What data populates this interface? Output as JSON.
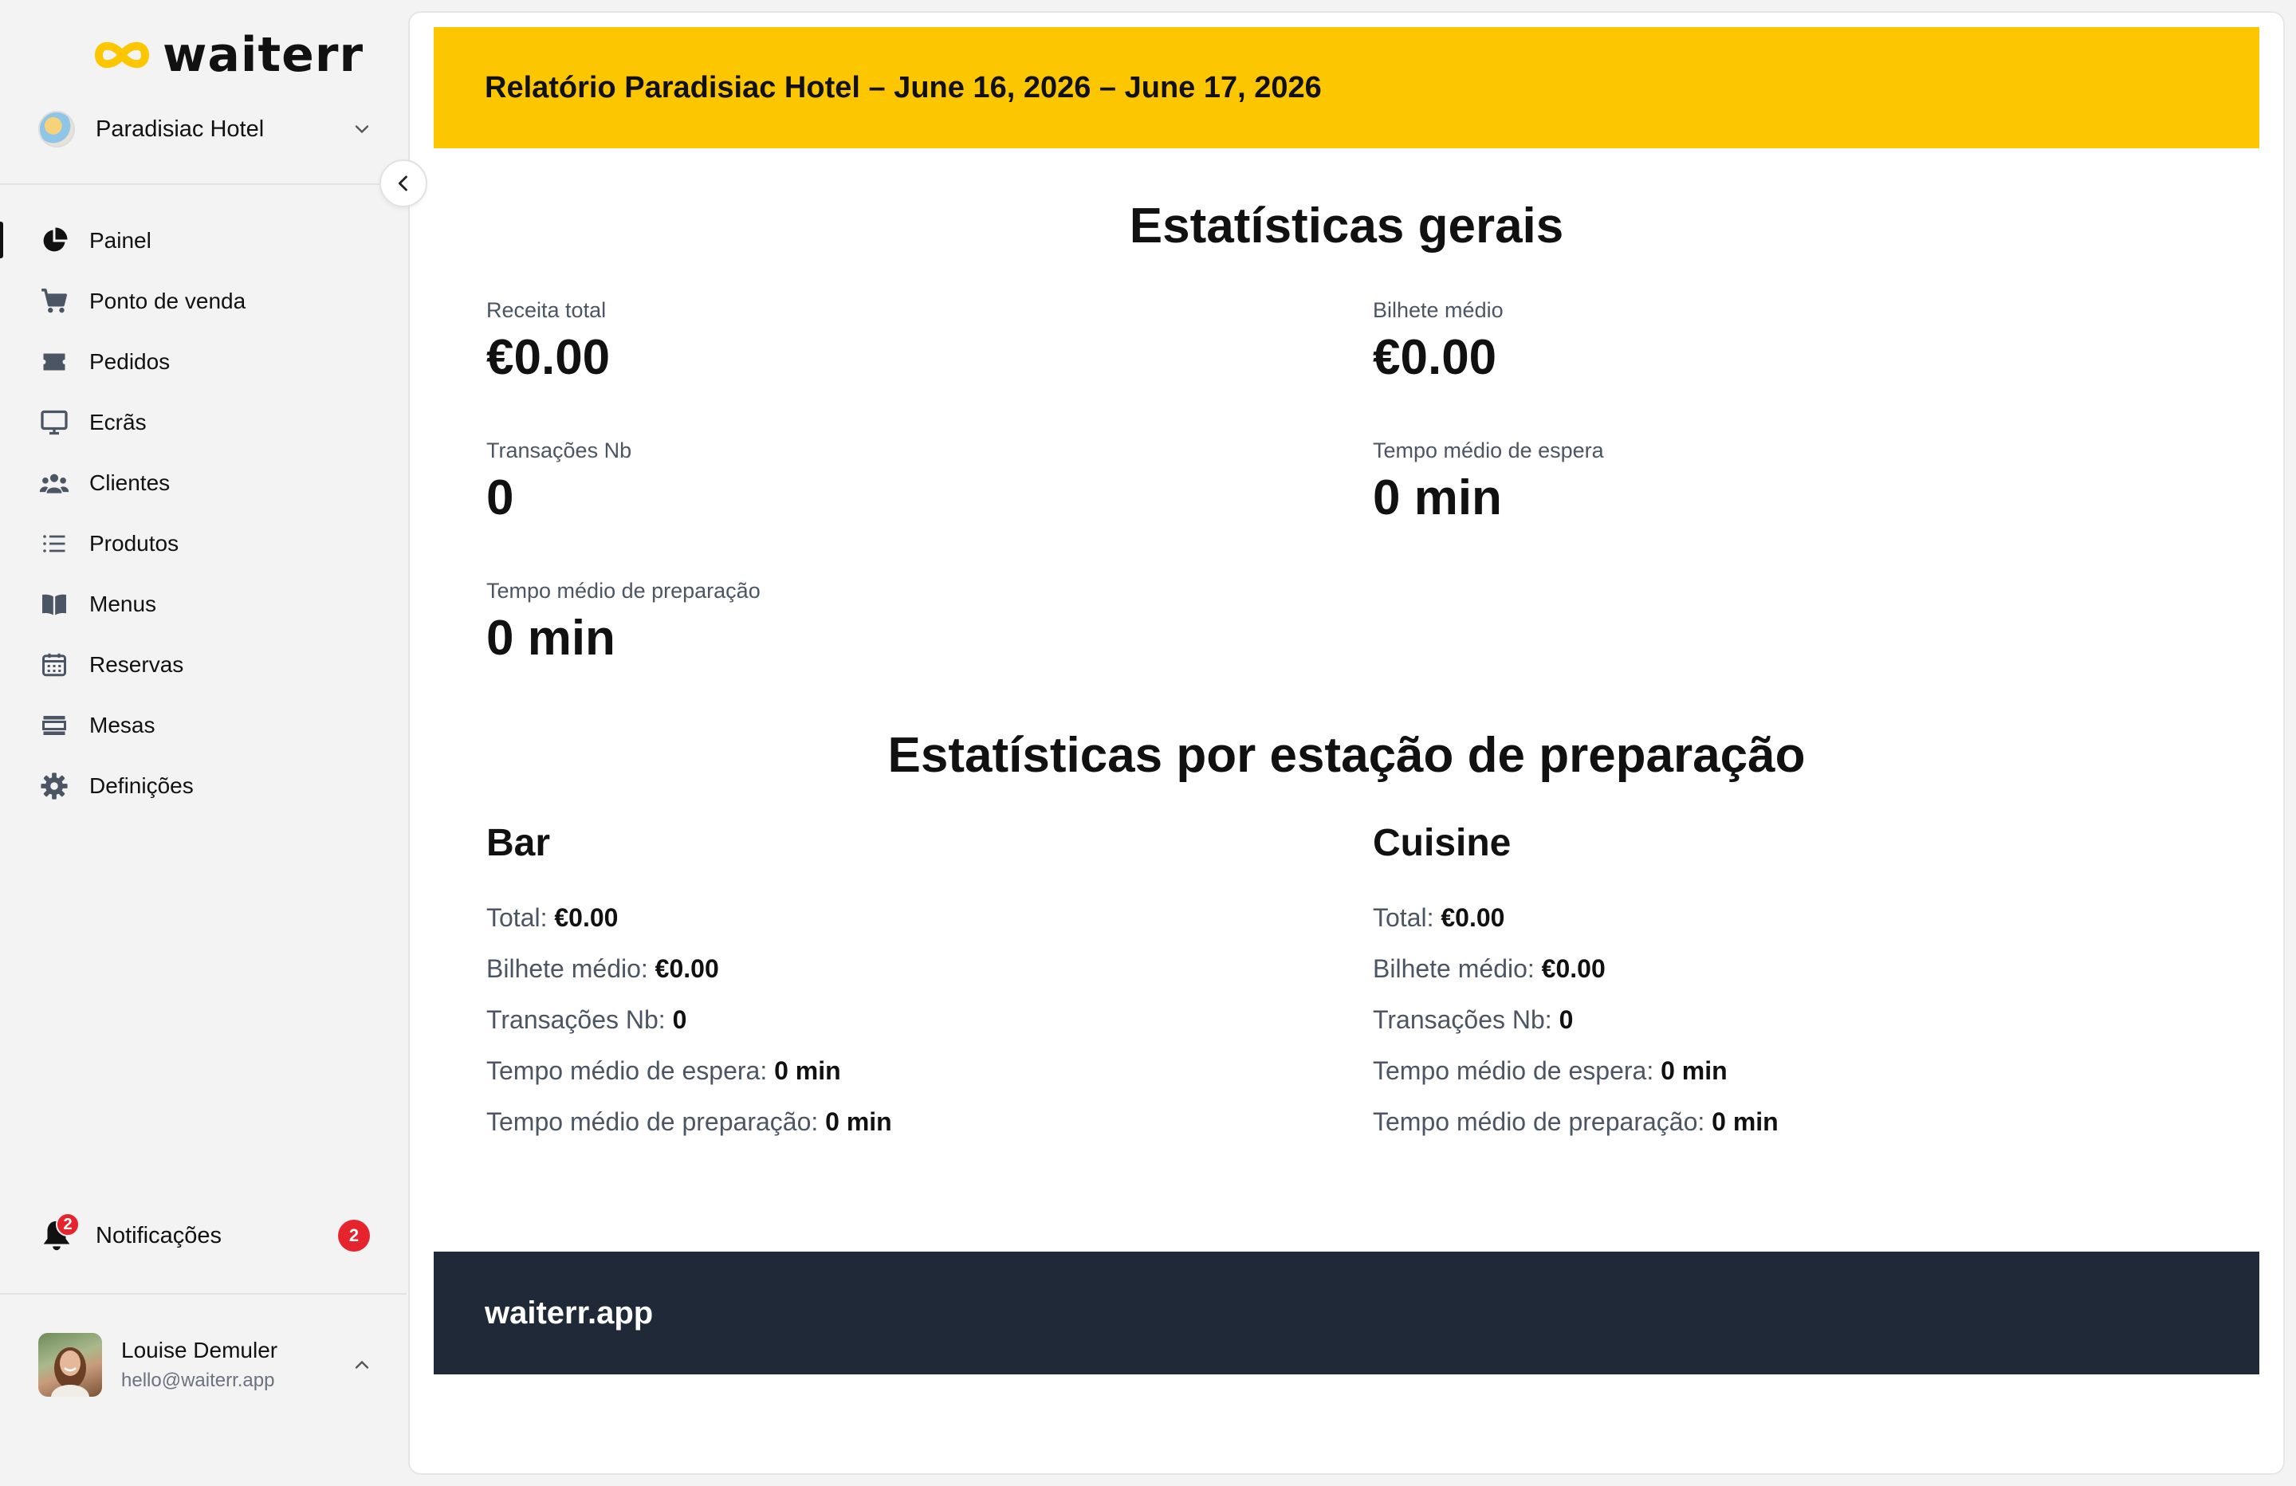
{
  "brand": {
    "name": "waiterr",
    "accent": "#fcc700"
  },
  "venue": {
    "name": "Paradisiac Hotel"
  },
  "nav": [
    {
      "label": "Painel",
      "icon": "pie-chart-icon",
      "active": true
    },
    {
      "label": "Ponto de venda",
      "icon": "cart-icon"
    },
    {
      "label": "Pedidos",
      "icon": "ticket-icon"
    },
    {
      "label": "Ecrãs",
      "icon": "monitor-icon"
    },
    {
      "label": "Clientes",
      "icon": "users-icon"
    },
    {
      "label": "Produtos",
      "icon": "list-icon"
    },
    {
      "label": "Menus",
      "icon": "book-icon"
    },
    {
      "label": "Reservas",
      "icon": "calendar-icon"
    },
    {
      "label": "Mesas",
      "icon": "table-icon"
    },
    {
      "label": "Definições",
      "icon": "gear-icon"
    }
  ],
  "notifications": {
    "label": "Notificações",
    "count": "2",
    "bell_badge": "2",
    "badge_color": "#e5242e"
  },
  "user": {
    "name": "Louise Demuler",
    "email": "hello@waiterr.app"
  },
  "report": {
    "title": "Relatório Paradisiac Hotel – June 16, 2026 – June 17, 2026",
    "general_title": "Estatísticas gerais",
    "stats": {
      "revenue": {
        "label": "Receita total",
        "value": "€0.00"
      },
      "avg_ticket": {
        "label": "Bilhete médio",
        "value": "€0.00"
      },
      "transactions": {
        "label": "Transações Nb",
        "value": "0"
      },
      "avg_wait": {
        "label": "Tempo médio de espera",
        "value": "0 min"
      },
      "avg_prep": {
        "label": "Tempo médio de preparação",
        "value": "0 min"
      }
    },
    "stations_title": "Estatísticas por estação de preparação",
    "stations": [
      {
        "name": "Bar",
        "rows": [
          {
            "label": "Total:",
            "value": "€0.00"
          },
          {
            "label": "Bilhete médio:",
            "value": "€0.00"
          },
          {
            "label": "Transações Nb:",
            "value": "0"
          },
          {
            "label": "Tempo médio de espera:",
            "value": "0 min"
          },
          {
            "label": "Tempo médio de preparação:",
            "value": "0 min"
          }
        ]
      },
      {
        "name": "Cuisine",
        "rows": [
          {
            "label": "Total:",
            "value": "€0.00"
          },
          {
            "label": "Bilhete médio:",
            "value": "€0.00"
          },
          {
            "label": "Transações Nb:",
            "value": "0"
          },
          {
            "label": "Tempo médio de espera:",
            "value": "0 min"
          },
          {
            "label": "Tempo médio de preparação:",
            "value": "0 min"
          }
        ]
      }
    ],
    "footer": "waiterr.app"
  }
}
